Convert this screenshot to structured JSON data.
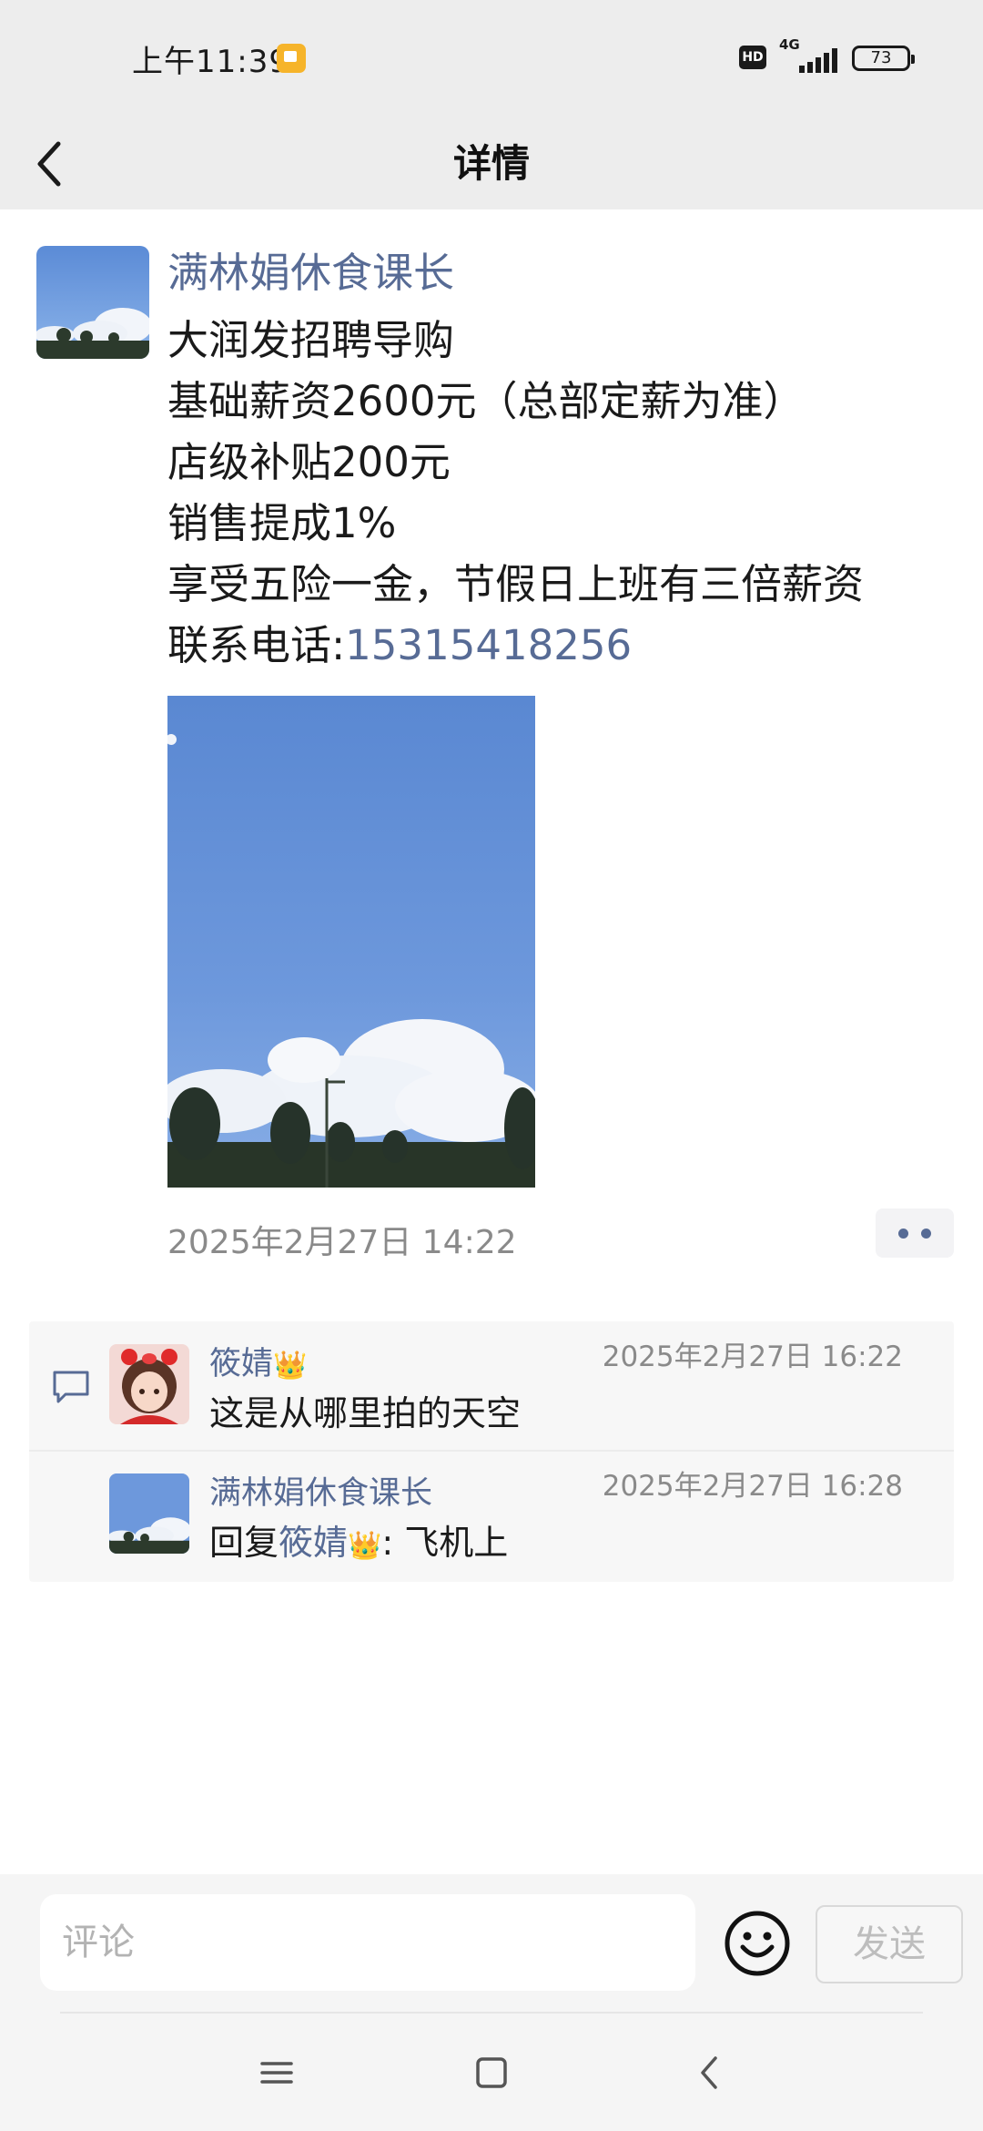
{
  "status_bar": {
    "time": "上午11:39",
    "hd_label": "HD",
    "network_label": "4G",
    "battery": "73"
  },
  "header": {
    "title": "详情",
    "back_icon": "chevron-left-icon"
  },
  "post": {
    "author": "满林娟休食课长",
    "lines": [
      "大润发招聘导购",
      "基础薪资2600元（总部定薪为准）",
      "店级补贴200元",
      "销售提成1%",
      "享受五险一金，节假日上班有三倍薪资"
    ],
    "contact_label": "联系电话:",
    "contact_phone": "15315418256",
    "timestamp": "2025年2月27日 14:22",
    "more_icon": "more-dots-icon"
  },
  "comments": [
    {
      "author": "筱婧",
      "time": "2025年2月27日 16:22",
      "text": "这是从哪里拍的天空"
    },
    {
      "author": "满林娟休食课长",
      "time": "2025年2月27日 16:28",
      "reply_prefix": "回复",
      "reply_to": "筱婧",
      "reply_text": ": 飞机上"
    }
  ],
  "input_bar": {
    "placeholder": "评论",
    "send_label": "发送",
    "emoji_icon": "smiley-icon"
  },
  "colors": {
    "link": "#576b95",
    "header_bg": "#ededed",
    "comments_bg": "#f7f7f7"
  }
}
